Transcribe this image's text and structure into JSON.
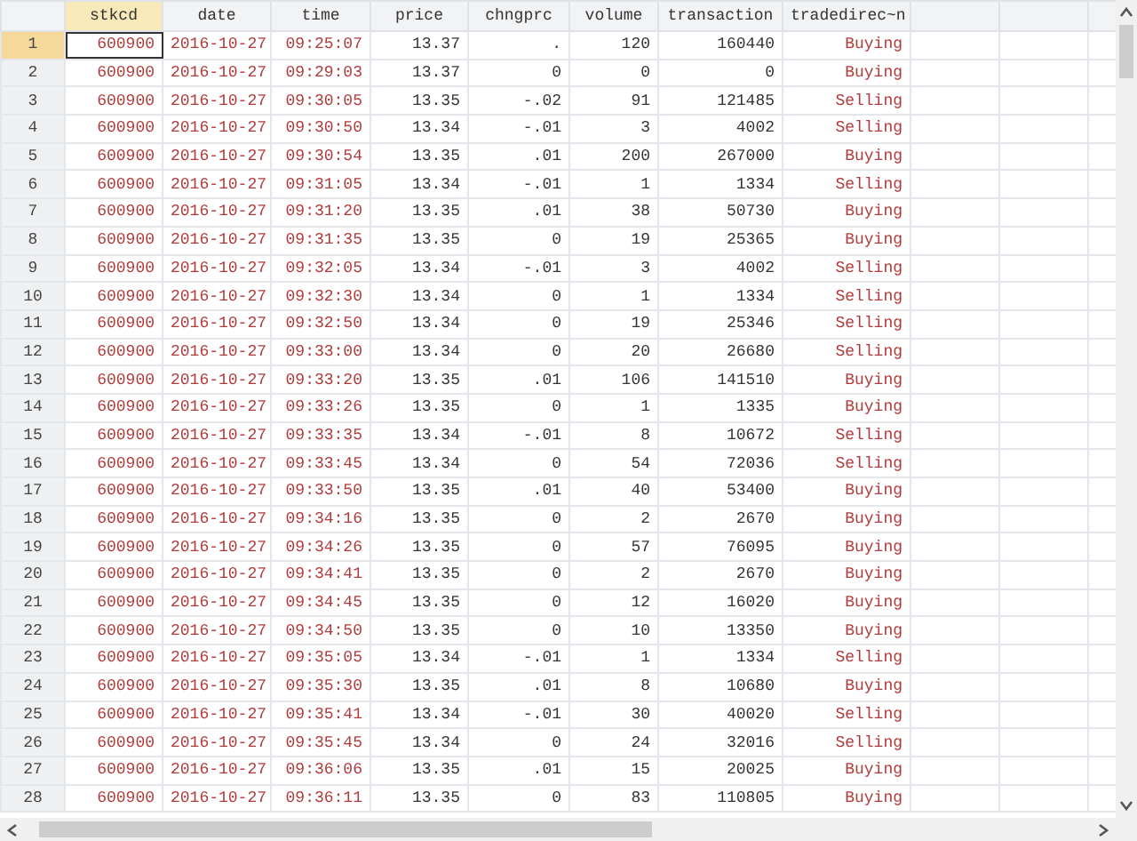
{
  "columns": [
    {
      "name": "stkcd",
      "kind": "string",
      "selected": true
    },
    {
      "name": "date",
      "kind": "string",
      "selected": false
    },
    {
      "name": "time",
      "kind": "string",
      "selected": false
    },
    {
      "name": "price",
      "kind": "numeric",
      "selected": false
    },
    {
      "name": "chngprc",
      "kind": "numeric",
      "selected": false
    },
    {
      "name": "volume",
      "kind": "numeric",
      "selected": false
    },
    {
      "name": "transaction",
      "kind": "numeric",
      "selected": false
    },
    {
      "name": "tradedirec~n",
      "kind": "string",
      "selected": false
    }
  ],
  "rows": [
    {
      "number": "1",
      "selected": true,
      "cells": [
        "600900",
        "2016-10-27",
        "09:25:07",
        "13.37",
        ".",
        "120",
        "160440",
        "Buying"
      ]
    },
    {
      "number": "2",
      "selected": false,
      "cells": [
        "600900",
        "2016-10-27",
        "09:29:03",
        "13.37",
        "0",
        "0",
        "0",
        "Buying"
      ]
    },
    {
      "number": "3",
      "selected": false,
      "cells": [
        "600900",
        "2016-10-27",
        "09:30:05",
        "13.35",
        "-.02",
        "91",
        "121485",
        "Selling"
      ]
    },
    {
      "number": "4",
      "selected": false,
      "cells": [
        "600900",
        "2016-10-27",
        "09:30:50",
        "13.34",
        "-.01",
        "3",
        "4002",
        "Selling"
      ]
    },
    {
      "number": "5",
      "selected": false,
      "cells": [
        "600900",
        "2016-10-27",
        "09:30:54",
        "13.35",
        ".01",
        "200",
        "267000",
        "Buying"
      ]
    },
    {
      "number": "6",
      "selected": false,
      "cells": [
        "600900",
        "2016-10-27",
        "09:31:05",
        "13.34",
        "-.01",
        "1",
        "1334",
        "Selling"
      ]
    },
    {
      "number": "7",
      "selected": false,
      "cells": [
        "600900",
        "2016-10-27",
        "09:31:20",
        "13.35",
        ".01",
        "38",
        "50730",
        "Buying"
      ]
    },
    {
      "number": "8",
      "selected": false,
      "cells": [
        "600900",
        "2016-10-27",
        "09:31:35",
        "13.35",
        "0",
        "19",
        "25365",
        "Buying"
      ]
    },
    {
      "number": "9",
      "selected": false,
      "cells": [
        "600900",
        "2016-10-27",
        "09:32:05",
        "13.34",
        "-.01",
        "3",
        "4002",
        "Selling"
      ]
    },
    {
      "number": "10",
      "selected": false,
      "cells": [
        "600900",
        "2016-10-27",
        "09:32:30",
        "13.34",
        "0",
        "1",
        "1334",
        "Selling"
      ]
    },
    {
      "number": "11",
      "selected": false,
      "cells": [
        "600900",
        "2016-10-27",
        "09:32:50",
        "13.34",
        "0",
        "19",
        "25346",
        "Selling"
      ]
    },
    {
      "number": "12",
      "selected": false,
      "cells": [
        "600900",
        "2016-10-27",
        "09:33:00",
        "13.34",
        "0",
        "20",
        "26680",
        "Selling"
      ]
    },
    {
      "number": "13",
      "selected": false,
      "cells": [
        "600900",
        "2016-10-27",
        "09:33:20",
        "13.35",
        ".01",
        "106",
        "141510",
        "Buying"
      ]
    },
    {
      "number": "14",
      "selected": false,
      "cells": [
        "600900",
        "2016-10-27",
        "09:33:26",
        "13.35",
        "0",
        "1",
        "1335",
        "Buying"
      ]
    },
    {
      "number": "15",
      "selected": false,
      "cells": [
        "600900",
        "2016-10-27",
        "09:33:35",
        "13.34",
        "-.01",
        "8",
        "10672",
        "Selling"
      ]
    },
    {
      "number": "16",
      "selected": false,
      "cells": [
        "600900",
        "2016-10-27",
        "09:33:45",
        "13.34",
        "0",
        "54",
        "72036",
        "Selling"
      ]
    },
    {
      "number": "17",
      "selected": false,
      "cells": [
        "600900",
        "2016-10-27",
        "09:33:50",
        "13.35",
        ".01",
        "40",
        "53400",
        "Buying"
      ]
    },
    {
      "number": "18",
      "selected": false,
      "cells": [
        "600900",
        "2016-10-27",
        "09:34:16",
        "13.35",
        "0",
        "2",
        "2670",
        "Buying"
      ]
    },
    {
      "number": "19",
      "selected": false,
      "cells": [
        "600900",
        "2016-10-27",
        "09:34:26",
        "13.35",
        "0",
        "57",
        "76095",
        "Buying"
      ]
    },
    {
      "number": "20",
      "selected": false,
      "cells": [
        "600900",
        "2016-10-27",
        "09:34:41",
        "13.35",
        "0",
        "2",
        "2670",
        "Buying"
      ]
    },
    {
      "number": "21",
      "selected": false,
      "cells": [
        "600900",
        "2016-10-27",
        "09:34:45",
        "13.35",
        "0",
        "12",
        "16020",
        "Buying"
      ]
    },
    {
      "number": "22",
      "selected": false,
      "cells": [
        "600900",
        "2016-10-27",
        "09:34:50",
        "13.35",
        "0",
        "10",
        "13350",
        "Buying"
      ]
    },
    {
      "number": "23",
      "selected": false,
      "cells": [
        "600900",
        "2016-10-27",
        "09:35:05",
        "13.34",
        "-.01",
        "1",
        "1334",
        "Selling"
      ]
    },
    {
      "number": "24",
      "selected": false,
      "cells": [
        "600900",
        "2016-10-27",
        "09:35:30",
        "13.35",
        ".01",
        "8",
        "10680",
        "Buying"
      ]
    },
    {
      "number": "25",
      "selected": false,
      "cells": [
        "600900",
        "2016-10-27",
        "09:35:41",
        "13.34",
        "-.01",
        "30",
        "40020",
        "Selling"
      ]
    },
    {
      "number": "26",
      "selected": false,
      "cells": [
        "600900",
        "2016-10-27",
        "09:35:45",
        "13.34",
        "0",
        "24",
        "32016",
        "Selling"
      ]
    },
    {
      "number": "27",
      "selected": false,
      "cells": [
        "600900",
        "2016-10-27",
        "09:36:06",
        "13.35",
        ".01",
        "15",
        "20025",
        "Buying"
      ]
    },
    {
      "number": "28",
      "selected": false,
      "cells": [
        "600900",
        "2016-10-27",
        "09:36:11",
        "13.35",
        "0",
        "83",
        "110805",
        "Buying"
      ]
    }
  ]
}
